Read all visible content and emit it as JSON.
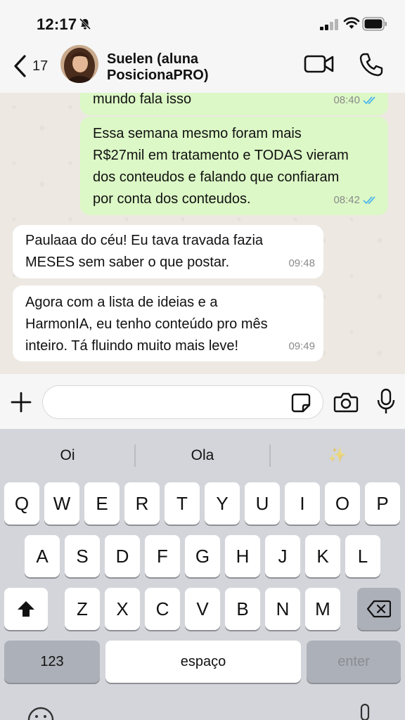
{
  "status": {
    "time": "12:17"
  },
  "header": {
    "back_count": "17",
    "contact_name": "Suelen (aluna\nPosicionaPRO)"
  },
  "messages": [
    {
      "side": "out",
      "text": "mundo fala isso",
      "time": "08:40",
      "read": true
    },
    {
      "side": "out",
      "text": "Essa semana mesmo foram mais\nR$27mil em tratamento e TODAS vieram\ndos conteudos e falando que confiaram\npor conta dos conteudos.",
      "time": "08:42",
      "read": true
    },
    {
      "side": "in",
      "text": "Paulaaa do céu! Eu tava travada fazia\nMESES sem saber o que postar.",
      "time": "09:48"
    },
    {
      "side": "in",
      "text": "Agora com a lista de ideias e a\nHarmonIA, eu tenho conteúdo pro mês\ninteiro. Tá fluindo muito mais leve!",
      "time": "09:49"
    }
  ],
  "composer": {
    "value": "",
    "placeholder": ""
  },
  "keyboard": {
    "suggestions": [
      "Oi",
      "Ola",
      "✨"
    ],
    "row1": [
      "Q",
      "W",
      "E",
      "R",
      "T",
      "Y",
      "U",
      "I",
      "O",
      "P"
    ],
    "row2": [
      "A",
      "S",
      "D",
      "F",
      "G",
      "H",
      "J",
      "K",
      "L"
    ],
    "row3": [
      "Z",
      "X",
      "C",
      "V",
      "B",
      "N",
      "M"
    ],
    "numbers_label": "123",
    "space_label": "espaço",
    "enter_label": "enter"
  },
  "icons": [
    "back-chevron-icon",
    "bell-off-icon",
    "signal-icon",
    "wifi-icon",
    "battery-icon",
    "video-call-icon",
    "phone-icon",
    "plus-icon",
    "sticker-icon",
    "camera-icon",
    "microphone-icon",
    "shift-icon",
    "backspace-icon",
    "emoji-icon",
    "dictation-icon",
    "read-ticks-icon"
  ],
  "colors": {
    "outgoing_bubble": "#dcf8c6",
    "incoming_bubble": "#ffffff",
    "read_ticks": "#4fb6ec",
    "keyboard_bg": "#d3d5da"
  }
}
